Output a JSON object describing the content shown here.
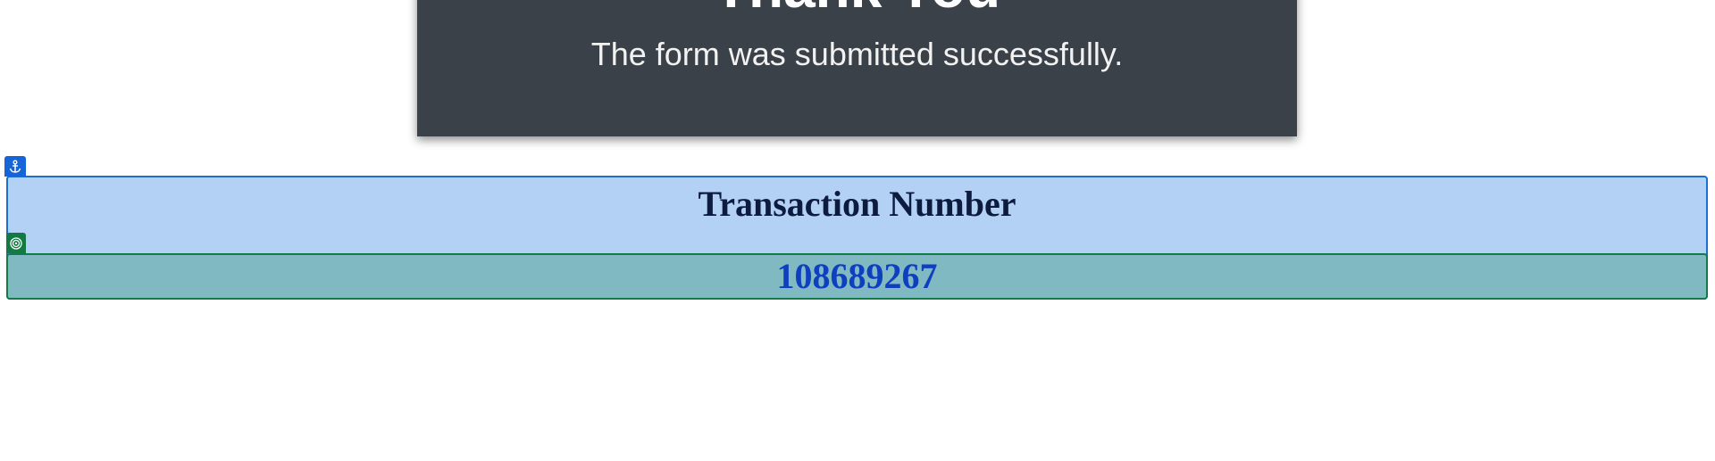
{
  "confirmation": {
    "title": "Thank You",
    "message": "The form was submitted successfully."
  },
  "highlight": {
    "outer_icon": "anchor-icon",
    "inner_icon": "target-icon",
    "outer_color": "#1a6fd1",
    "inner_color": "#117a4b"
  },
  "transaction": {
    "label": "Transaction Number",
    "number": "108689267"
  }
}
